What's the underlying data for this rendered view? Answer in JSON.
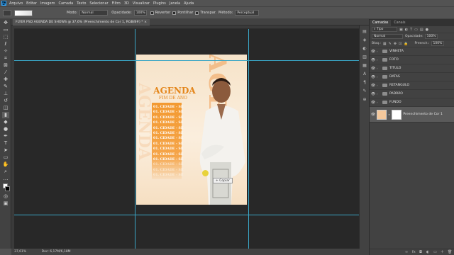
{
  "app": {
    "logo": "Ps"
  },
  "menu": [
    "Arquivo",
    "Editar",
    "Imagem",
    "Camada",
    "Texto",
    "Selecionar",
    "Filtro",
    "3D",
    "Visualizar",
    "Plugins",
    "Janela",
    "Ajuda"
  ],
  "options": {
    "mode_label": "Modo:",
    "mode_value": "Normal",
    "opacity_label": "Opacidade:",
    "opacity_value": "100%",
    "reverse_label": "Reverter",
    "dither_label": "Pontilhar",
    "transparency_label": "Transpar.",
    "method_label": "Método:",
    "method_value": "Perceptual"
  },
  "document": {
    "tab_title": "FLYER PSD AGENDA DE SHOWS @ 37,6% (Preenchimento de Cor 1, RGB/8#) *",
    "status_zoom": "37,61%",
    "status_doc": "Doc: 6,17M/6,18M"
  },
  "artwork": {
    "agenda_title": "AGENDA",
    "agenda_subtitle": "FIM DE ANO",
    "big_vertical": "AGENDA",
    "date_rows": [
      "01. CIDADE - SE",
      "01. CIDADE - SE",
      "01. CIDADE - SE",
      "01. CIDADE - SE",
      "01. CIDADE - SE",
      "01. CIDADE - SE",
      "01. CIDADE - SE",
      "01. CIDADE - SE",
      "01. CIDADE - SE",
      "01. CIDADE - SE",
      "01. CIDADE - SE",
      "01. CIDADE - SE",
      "01. CIDADE - SE",
      "01. CIDADE - SE"
    ],
    "copy_tooltip": "Copiar"
  },
  "layers_panel": {
    "tabs": [
      "Camadas",
      "Canais"
    ],
    "filter_value": "Tipo",
    "blend_value": "Normal",
    "opacity_label": "Opacidade:",
    "opacity_value": "100%",
    "lock_label": "Bloq.:",
    "fill_label": "Preench.:",
    "fill_value": "100%",
    "layers": [
      {
        "name": "VINHETA"
      },
      {
        "name": "FOTO"
      },
      {
        "name": "TITULO"
      },
      {
        "name": "DATAS"
      },
      {
        "name": "RETANGULO"
      },
      {
        "name": "PADRÃO"
      },
      {
        "name": "FUNDO"
      }
    ],
    "selected_layer": "Preenchimento de Cor 1"
  },
  "colors": {
    "accent": "#e4861b",
    "guides": "#3aa6c6"
  }
}
